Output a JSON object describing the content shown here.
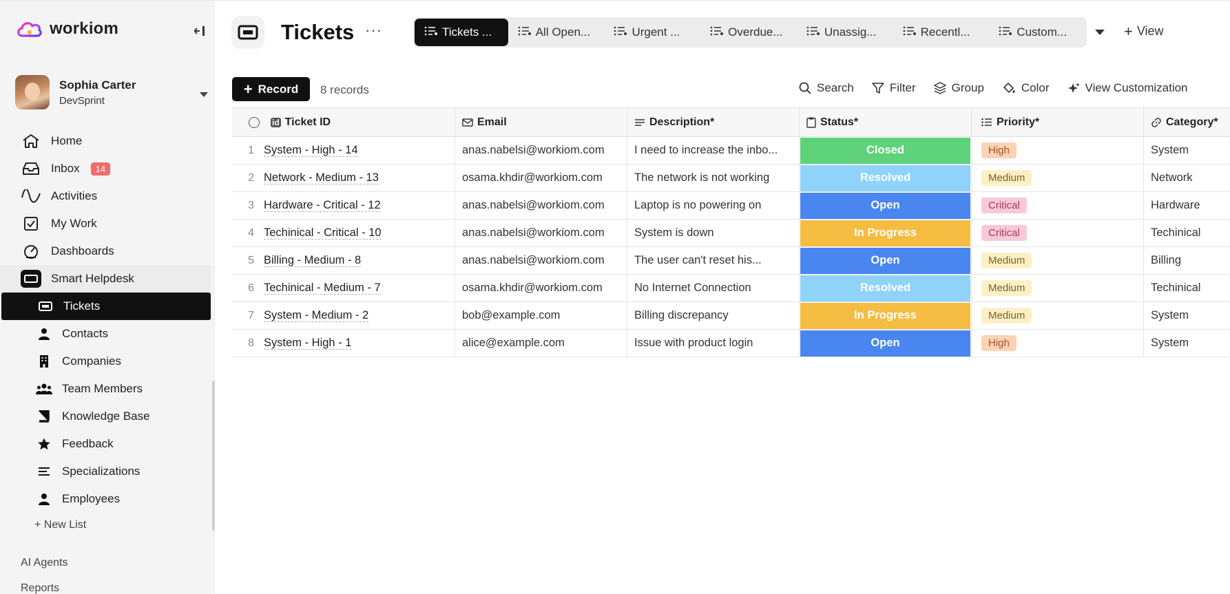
{
  "brand": {
    "name": "workiom"
  },
  "user": {
    "name": "Sophia Carter",
    "org": "DevSprint"
  },
  "nav": {
    "home": "Home",
    "inbox": "Inbox",
    "inbox_badge": "14",
    "activities": "Activities",
    "mywork": "My Work",
    "dashboards": "Dashboards",
    "app": "Smart Helpdesk",
    "lists": [
      {
        "label": "Tickets",
        "icon": "ticket-icon",
        "active": true
      },
      {
        "label": "Contacts",
        "icon": "person-icon"
      },
      {
        "label": "Companies",
        "icon": "building-icon"
      },
      {
        "label": "Team Members",
        "icon": "people-icon"
      },
      {
        "label": "Knowledge Base",
        "icon": "book-icon"
      },
      {
        "label": "Feedback",
        "icon": "star-icon"
      },
      {
        "label": "Specializations",
        "icon": "lines-icon"
      },
      {
        "label": "Employees",
        "icon": "person-icon"
      }
    ],
    "new_list": "+ New List",
    "ai_agents": "AI Agents",
    "reports": "Reports"
  },
  "header": {
    "title": "Tickets",
    "more": "···",
    "tabs": [
      "Tickets ...",
      "All Open...",
      "Urgent ...",
      "Overdue...",
      "Unassig...",
      "Recentl...",
      "Custom..."
    ],
    "add_view": "View"
  },
  "toolbar": {
    "record": "Record",
    "count": "8 records",
    "search": "Search",
    "filter": "Filter",
    "group": "Group",
    "color": "Color",
    "customize": "View Customization"
  },
  "table": {
    "columns": {
      "id": "Ticket ID",
      "email": "Email",
      "desc": "Description*",
      "status": "Status*",
      "priority": "Priority*",
      "category": "Category*"
    },
    "rows": [
      {
        "n": "1",
        "id": "System - High - 14",
        "email": "anas.nabelsi@workiom.com",
        "desc": "I need to increase the inbo...",
        "status": "Closed",
        "priority": "High",
        "category": "System"
      },
      {
        "n": "2",
        "id": "Network - Medium - 13",
        "email": "osama.khdir@workiom.com",
        "desc": "The network is not working",
        "status": "Resolved",
        "priority": "Medium",
        "category": "Network"
      },
      {
        "n": "3",
        "id": "Hardware - Critical - 12",
        "email": "anas.nabelsi@workiom.com",
        "desc": "Laptop is no powering on",
        "status": "Open",
        "priority": "Critical",
        "category": "Hardware"
      },
      {
        "n": "4",
        "id": "Techinical - Critical - 10",
        "email": "anas.nabelsi@workiom.com",
        "desc": "System is down",
        "status": "In Progress",
        "priority": "Critical",
        "category": "Techinical"
      },
      {
        "n": "5",
        "id": "Billing - Medium - 8",
        "email": "anas.nabelsi@workiom.com",
        "desc": "The user can't reset his...",
        "status": "Open",
        "priority": "Medium",
        "category": "Billing"
      },
      {
        "n": "6",
        "id": "Techinical - Medium - 7",
        "email": "osama.khdir@workiom.com",
        "desc": "No Internet Connection",
        "status": "Resolved",
        "priority": "Medium",
        "category": "Techinical"
      },
      {
        "n": "7",
        "id": "System - Medium - 2",
        "email": "bob@example.com",
        "desc": "Billing discrepancy",
        "status": "In Progress",
        "priority": "Medium",
        "category": "System"
      },
      {
        "n": "8",
        "id": "System - High - 1",
        "email": "alice@example.com",
        "desc": "Issue with product login",
        "status": "Open",
        "priority": "High",
        "category": "System"
      }
    ]
  },
  "colors": {
    "status": {
      "Closed": "#5ed27a",
      "Resolved": "#8fd3fa",
      "Open": "#4a86f0",
      "In Progress": "#f4bd41"
    },
    "priority": {
      "High": {
        "bg": "#fcd3b5",
        "fg": "#a0522d"
      },
      "Medium": {
        "bg": "#fdf0c7",
        "fg": "#7a6220"
      },
      "Critical": {
        "bg": "#f8c9d9",
        "fg": "#a33a5e"
      }
    }
  }
}
